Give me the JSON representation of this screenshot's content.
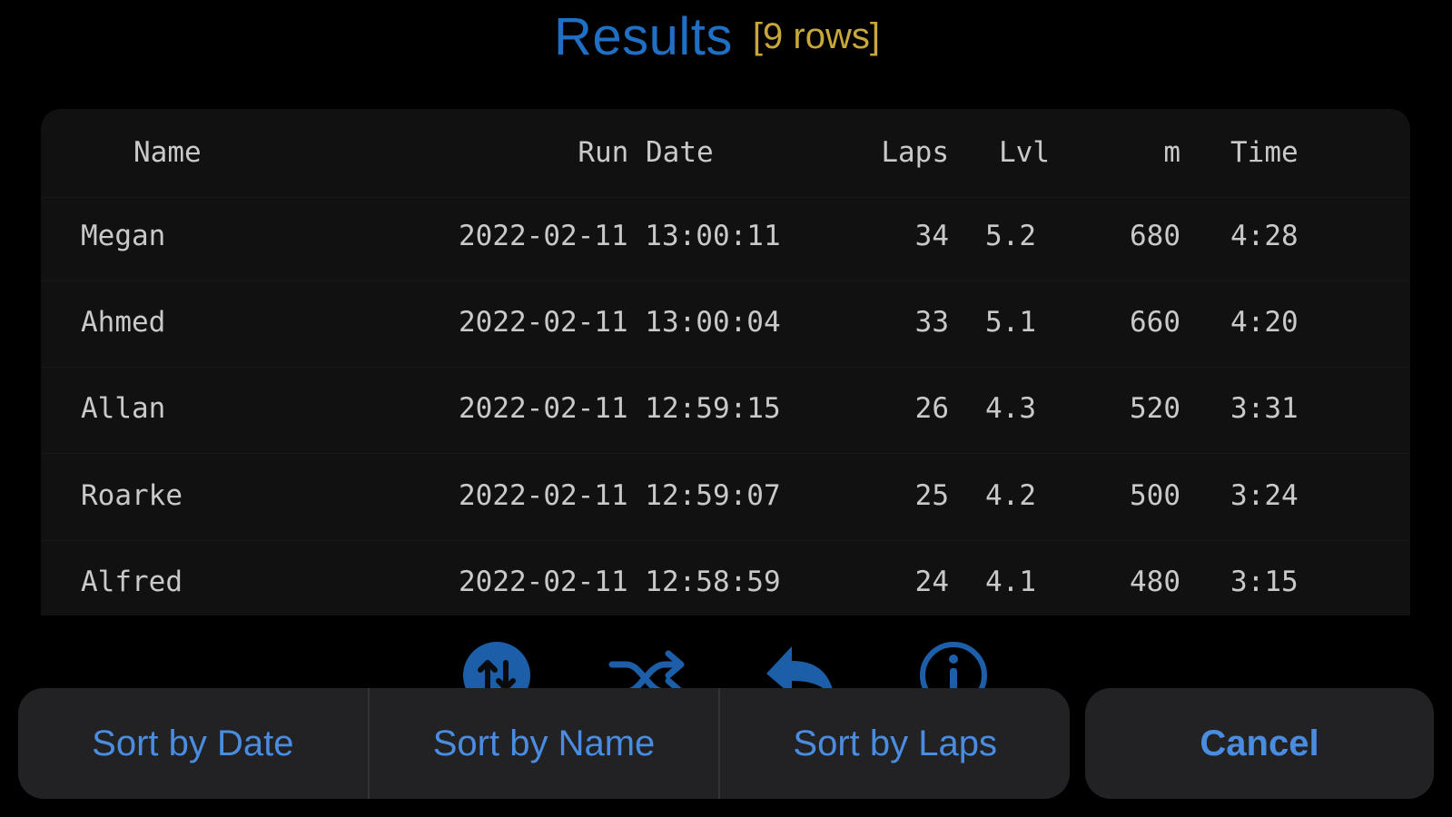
{
  "header": {
    "title": "Results",
    "row_count": "[9 rows]"
  },
  "table": {
    "columns": [
      "Name",
      "Run Date",
      "Laps",
      "Lvl",
      "m",
      "Time"
    ],
    "rows": [
      [
        "Megan",
        "2022-02-11 13:00:11",
        "34",
        "5.2",
        "680",
        "4:28"
      ],
      [
        "Ahmed",
        "2022-02-11 13:00:04",
        "33",
        "5.1",
        "660",
        "4:20"
      ],
      [
        "Allan",
        "2022-02-11 12:59:15",
        "26",
        "4.3",
        "520",
        "3:31"
      ],
      [
        "Roarke",
        "2022-02-11 12:59:07",
        "25",
        "4.2",
        "500",
        "3:24"
      ],
      [
        "Alfred",
        "2022-02-11 12:58:59",
        "24",
        "4.1",
        "480",
        "3:15"
      ]
    ]
  },
  "toolbar": {
    "icons": [
      "sort-icon",
      "shuffle-icon",
      "back-icon",
      "info-icon"
    ]
  },
  "action_sheet": {
    "sort_by_date": "Sort by Date",
    "sort_by_name": "Sort by Name",
    "sort_by_laps": "Sort by Laps",
    "cancel": "Cancel"
  },
  "colors": {
    "accent": "#1f6fc4",
    "button_text": "#4a8de0",
    "count": "#c8a83a",
    "background": "#000000",
    "panel": "#111111",
    "sheet": "#222224"
  }
}
